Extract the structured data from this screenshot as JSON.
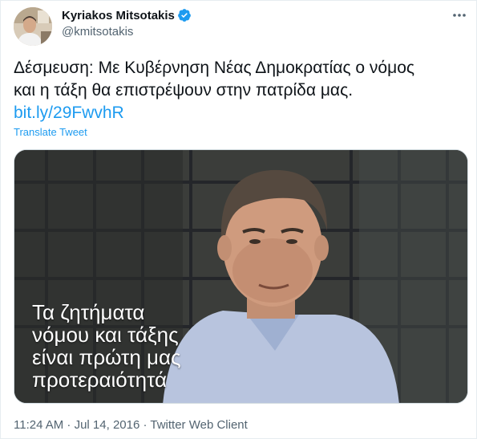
{
  "author": {
    "name": "Kyriakos Mitsotakis",
    "handle": "@kmitsotakis",
    "verified": true
  },
  "tweet": {
    "text_line_1": "Δέσμευση: Με Κυβέρνηση Νέας Δημοκρατίας ο νόμος",
    "text_line_2": "και η τάξη θα επιστρέψουν στην πατρίδα μας.",
    "link": "bit.ly/29FwvhR",
    "translate_label": "Translate Tweet"
  },
  "media": {
    "caption_lines": [
      "Τα ζητήματα",
      "νόμου και τάξης",
      "είναι πρώτη μας",
      "προτεραιότητά"
    ]
  },
  "meta": {
    "line": "11:24 AM · Jul 14, 2016 · Twitter Web Client"
  },
  "colors": {
    "accent": "#1d9bf0",
    "secondary_text": "#536471"
  },
  "icons": {
    "verified": "verified-badge-icon",
    "more": "more-horizontal-icon"
  }
}
